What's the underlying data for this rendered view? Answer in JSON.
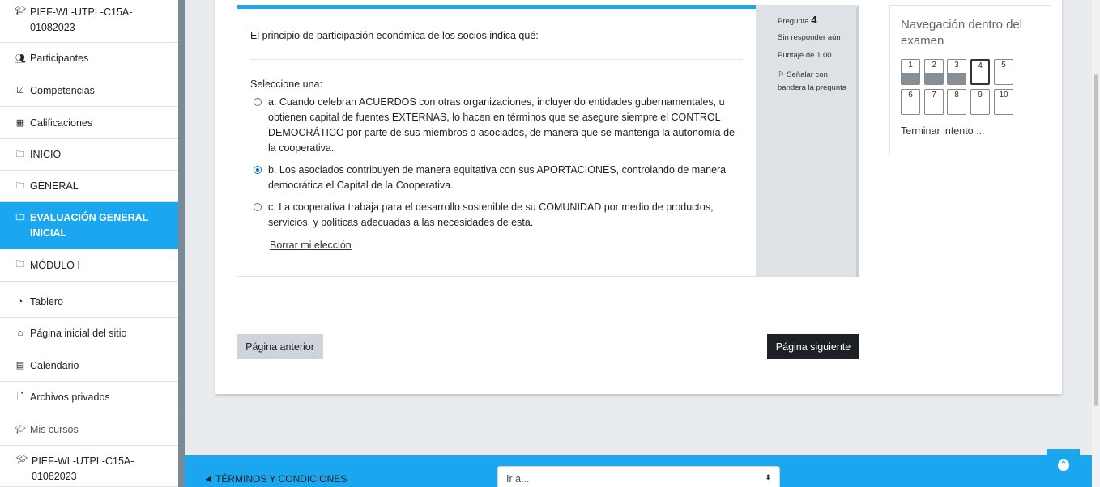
{
  "sidebar": {
    "course_top": "PIEF-WL-UTPL-C15A-01082023",
    "items": [
      {
        "label": "Participantes",
        "icon": "users-icon"
      },
      {
        "label": "Competencias",
        "icon": "checkbox-icon"
      },
      {
        "label": "Calificaciones",
        "icon": "table-icon"
      },
      {
        "label": "INICIO",
        "icon": "folder-icon"
      },
      {
        "label": "GENERAL",
        "icon": "folder-icon"
      },
      {
        "label": "EVALUACIÓN GENERAL INICIAL",
        "icon": "folder-icon"
      },
      {
        "label": "MÓDULO I",
        "icon": "folder-icon"
      }
    ],
    "items2": [
      {
        "label": "Tablero",
        "icon": "dashboard-icon"
      },
      {
        "label": "Página inicial del sitio",
        "icon": "home-icon"
      },
      {
        "label": "Calendario",
        "icon": "calendar-icon"
      },
      {
        "label": "Archivos privados",
        "icon": "file-icon"
      },
      {
        "label": "Mis cursos",
        "icon": "graduation-cap-icon"
      }
    ],
    "course_bottom": "PIEF-WL-UTPL-C15A-01082023"
  },
  "question": {
    "text": "El principio de participación económica de los socios indica qué:",
    "prompt": "Seleccione una:",
    "options": [
      {
        "label": "a. Cuando celebran ACUERDOS con otras organizaciones, incluyendo entidades gubernamentales, u obtienen capital de fuentes EXTERNAS, lo hacen en términos que se asegure siempre el CONTROL DEMOCRÁTICO por parte de sus miembros o asociados, de manera que se mantenga la autonomía de la cooperativa.",
        "selected": false
      },
      {
        "label": "b. Los asociados contribuyen de manera equitativa con sus APORTACIONES, controlando de manera democrática el Capital de la Cooperativa.",
        "selected": true
      },
      {
        "label": "c. La cooperativa trabaja para el desarrollo sostenible de su COMUNIDAD por medio de productos, servicios, y políticas adecuadas a las necesidades de esta.",
        "selected": false
      }
    ],
    "clear": "Borrar mi elección"
  },
  "info": {
    "num_label": "Pregunta",
    "num": "4",
    "state": "Sin responder aún",
    "grade": "Puntaje de 1.00",
    "flag": "Señalar con bandera la pregunta"
  },
  "nav": {
    "title": "Navegación dentro del examen",
    "buttons": [
      {
        "n": "1",
        "state": "answered"
      },
      {
        "n": "2",
        "state": "answered"
      },
      {
        "n": "3",
        "state": "answered"
      },
      {
        "n": "4",
        "state": "current"
      },
      {
        "n": "5",
        "state": "notyet"
      },
      {
        "n": "6",
        "state": "notyet"
      },
      {
        "n": "7",
        "state": "notyet"
      },
      {
        "n": "8",
        "state": "notyet"
      },
      {
        "n": "9",
        "state": "notyet"
      },
      {
        "n": "10",
        "state": "notyet"
      }
    ],
    "finish": "Terminar intento ..."
  },
  "buttons": {
    "prev": "Página anterior",
    "next": "Página siguiente"
  },
  "footer": {
    "terms": "◄ TÉRMINOS Y CONDICIONES",
    "goto": "Ir a...",
    "accent": "#1ba7f0"
  }
}
